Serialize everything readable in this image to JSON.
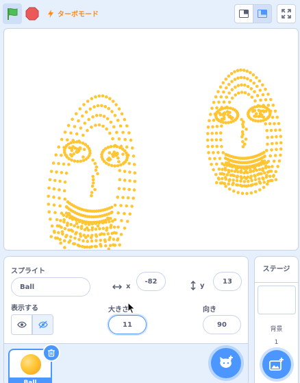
{
  "toolbar": {
    "turbo_label": "ターボモード",
    "accent_color": "#4c97ff",
    "flag_color": "#4cbf56",
    "stop_color": "#ec5959",
    "turbo_color": "#ff8c1a"
  },
  "stage": {
    "dot_color": "#ffc533"
  },
  "sprite_info": {
    "sprite_label": "スプライト",
    "sprite_name": "Ball",
    "x_label": "x",
    "x_value": "-82",
    "y_label": "y",
    "y_value": "13",
    "show_label": "表示する",
    "size_label": "大きさ",
    "size_value": "11",
    "direction_label": "向き",
    "direction_value": "90"
  },
  "sprite_list": {
    "items": [
      {
        "name": "Ball",
        "selected": true
      }
    ]
  },
  "stage_panel": {
    "title": "ステージ",
    "backdrop_label": "背景",
    "backdrop_count": "1"
  }
}
